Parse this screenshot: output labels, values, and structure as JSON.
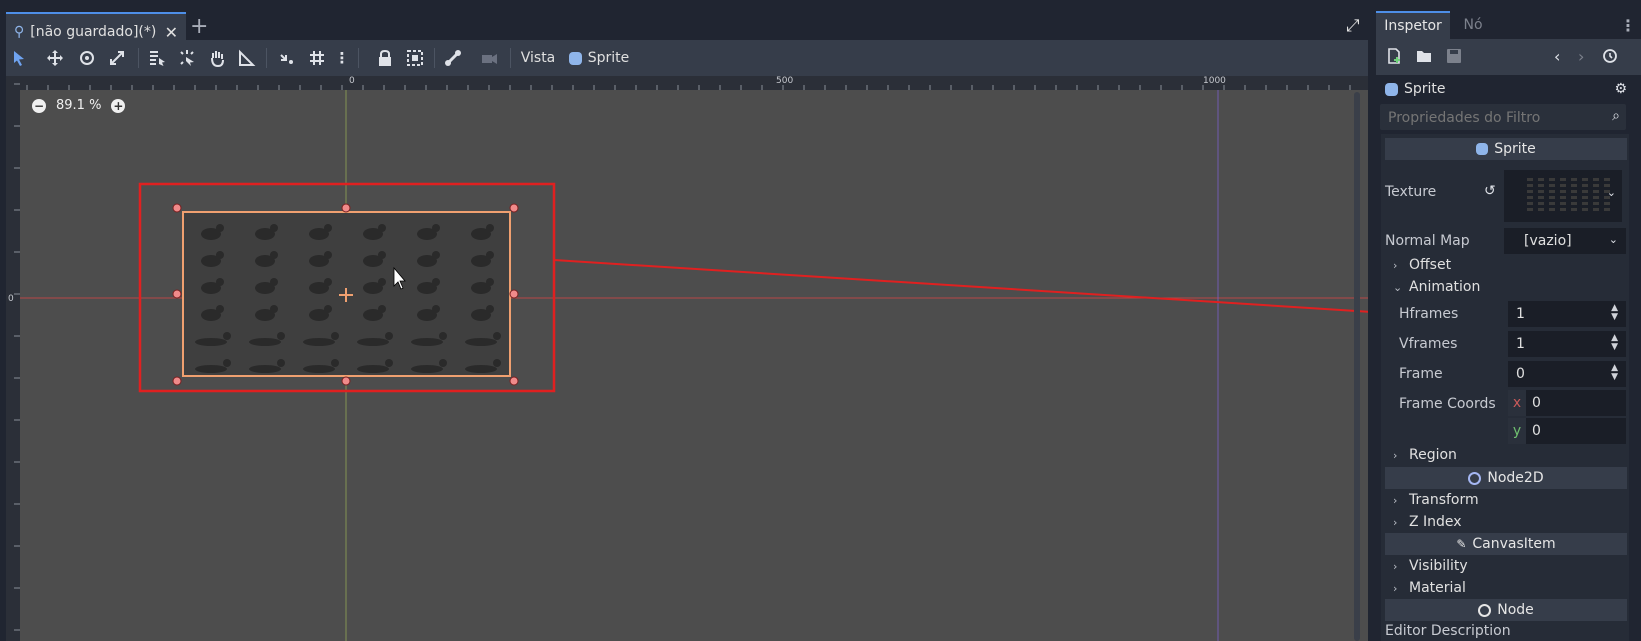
{
  "editor": {
    "scene_tab": "[não guardado](*)",
    "close_glyph": "✕",
    "add_tab_glyph": "+"
  },
  "toolbar": {
    "view_menu": "Vista",
    "node_label": "Sprite"
  },
  "canvas": {
    "zoom_text": "89.1 %",
    "ruler_top": [
      "0",
      "500",
      "1000"
    ],
    "ruler_left": [
      "0"
    ]
  },
  "inspector": {
    "tabs": [
      "Inspetor",
      "Nó"
    ],
    "selected_node": "Sprite",
    "filter_placeholder": "Propriedades do Filtro",
    "sections": {
      "sprite": "Sprite",
      "node2d": "Node2D",
      "canvasitem": "CanvasItem",
      "node": "Node"
    },
    "texture_label": "Texture",
    "normal_map_label": "Normal Map",
    "normal_map_value": "[vazio]",
    "groups": {
      "offset": "Offset",
      "animation": "Animation",
      "region": "Region",
      "transform": "Transform",
      "z_index": "Z Index",
      "visibility": "Visibility",
      "material": "Material"
    },
    "props": {
      "hframes_label": "Hframes",
      "hframes_value": "1",
      "vframes_label": "Vframes",
      "vframes_value": "1",
      "frame_label": "Frame",
      "frame_value": "0",
      "frame_coords_label": "Frame Coords",
      "coord_x_label": "x",
      "coord_x_value": "0",
      "coord_y_label": "y",
      "coord_y_value": "0"
    },
    "editor_description": "Editor Description"
  },
  "colors": {
    "accent": "#4e8fe8",
    "annotation_red": "#e02020",
    "selection_orange": "#f0a070"
  }
}
